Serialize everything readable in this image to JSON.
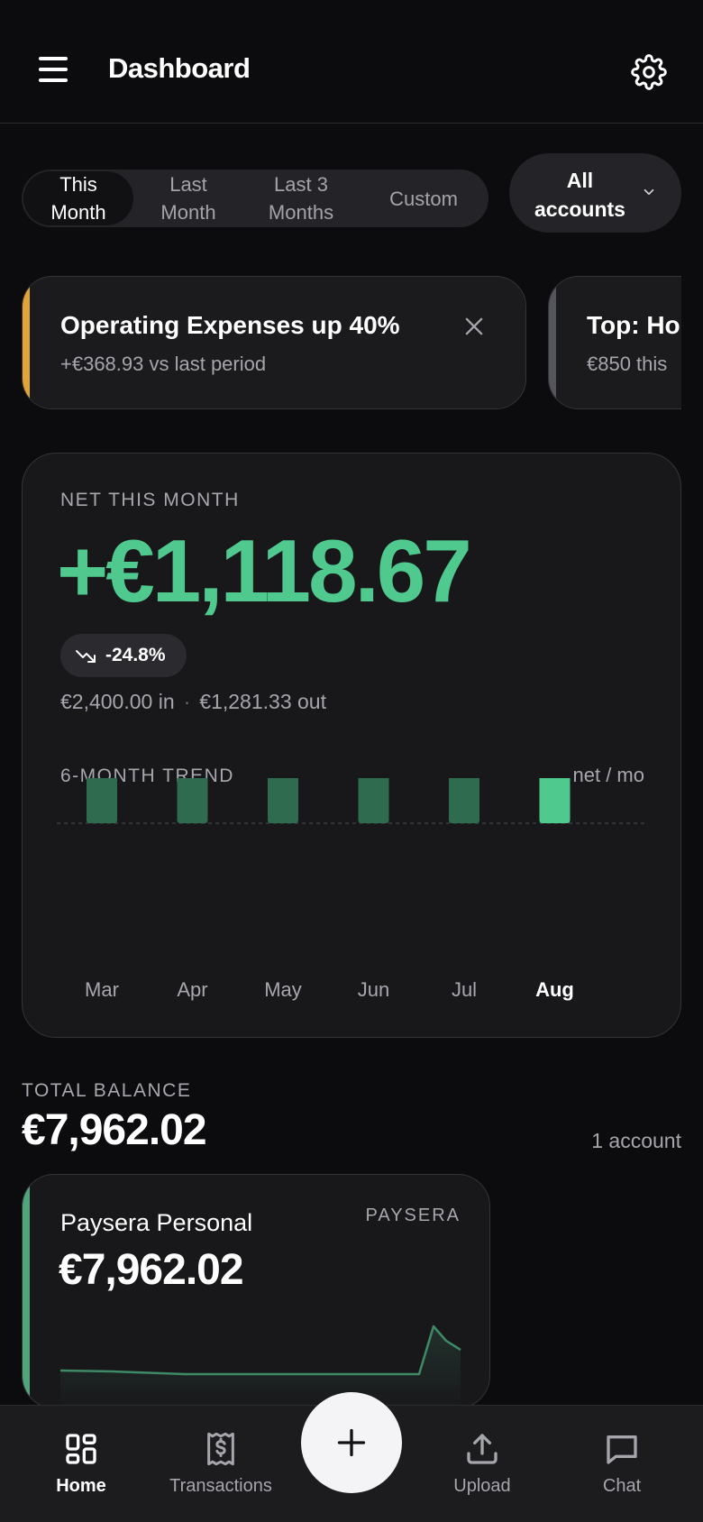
{
  "header": {
    "title": "Dashboard"
  },
  "filters": {
    "periods": [
      {
        "label": "This\nMonth",
        "active": true
      },
      {
        "label": "Last\nMonth",
        "active": false
      },
      {
        "label": "Last 3\nMonths",
        "active": false
      },
      {
        "label": "Custom",
        "active": false
      }
    ],
    "account_select": "All\naccounts"
  },
  "insights": [
    {
      "title": "Operating Expenses up 40%",
      "subtitle": "+€368.93 vs last period",
      "accent": "#e0a43a"
    },
    {
      "title": "Top: Hou",
      "subtitle": "€850 this",
      "accent": "#55555c"
    }
  ],
  "net": {
    "label": "NET THIS MONTH",
    "amount": "+€1,118.67",
    "delta": "-24.8%",
    "in_text": "€2,400.00 in",
    "separator": "·",
    "out_text": "€1,281.33 out",
    "trend_label": "6-MONTH TREND",
    "trend_unit": "net / mo"
  },
  "chart_data": {
    "type": "bar",
    "categories": [
      "Mar",
      "Apr",
      "May",
      "Jun",
      "Jul",
      "Aug"
    ],
    "values": [
      1118.67,
      1118.67,
      1118.67,
      1118.67,
      1118.67,
      1118.67
    ],
    "highlight_index": 5,
    "colors": {
      "past": "#2f6b4e",
      "current": "#4fc98e"
    },
    "baseline": 0
  },
  "balance": {
    "label": "TOTAL BALANCE",
    "amount": "€7,962.02",
    "account_count": "1 account",
    "accounts": [
      {
        "name": "Paysera Personal",
        "bank": "PAYSERA",
        "balance": "€7,962.02"
      }
    ]
  },
  "nav": {
    "items": [
      {
        "label": "Home",
        "icon": "home-grid-icon",
        "active": true
      },
      {
        "label": "Transactions",
        "icon": "receipt-icon",
        "active": false
      },
      {
        "label": "Upload",
        "icon": "upload-icon",
        "active": false
      },
      {
        "label": "Chat",
        "icon": "chat-icon",
        "active": false
      }
    ],
    "fab_icon": "plus-icon"
  }
}
